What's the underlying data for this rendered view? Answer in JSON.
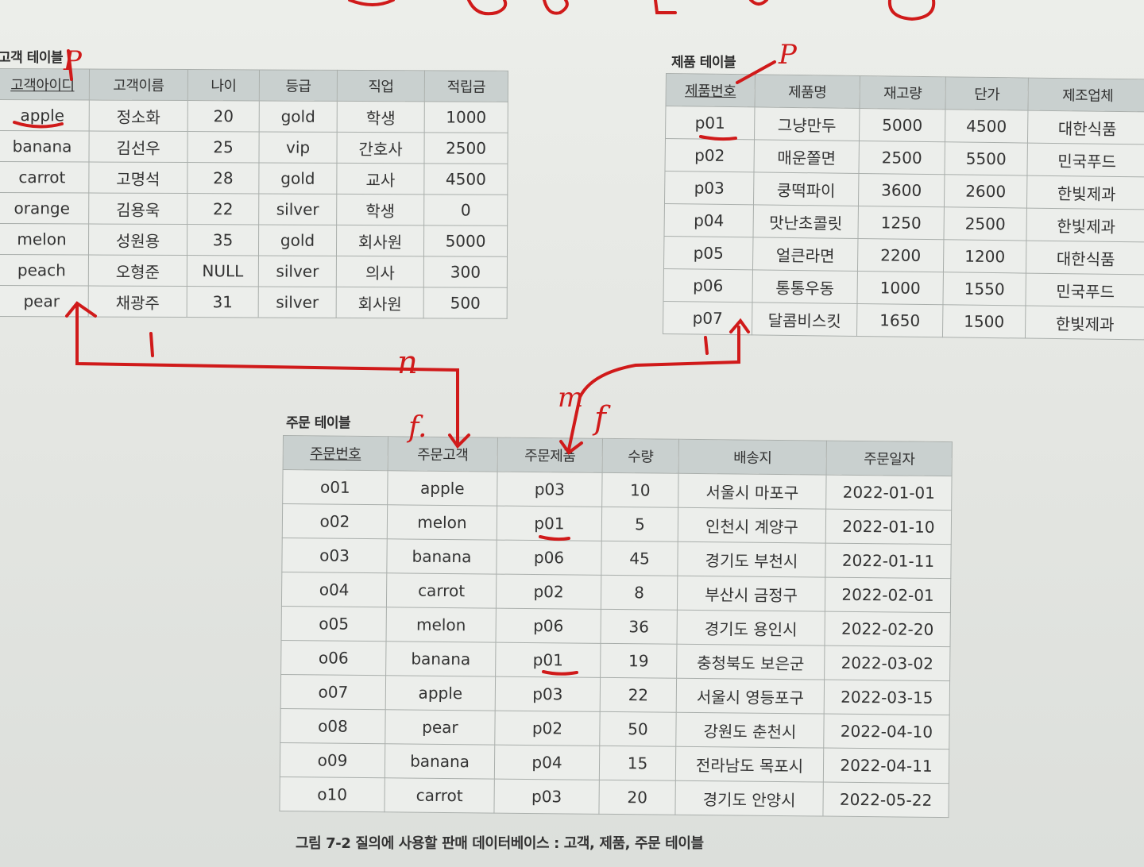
{
  "customer": {
    "title": "고객 테이블",
    "headers": [
      "고객아이디",
      "고객이름",
      "나이",
      "등급",
      "직업",
      "적립금"
    ],
    "rows": [
      [
        "apple",
        "정소화",
        "20",
        "gold",
        "학생",
        "1000"
      ],
      [
        "banana",
        "김선우",
        "25",
        "vip",
        "간호사",
        "2500"
      ],
      [
        "carrot",
        "고명석",
        "28",
        "gold",
        "교사",
        "4500"
      ],
      [
        "orange",
        "김용욱",
        "22",
        "silver",
        "학생",
        "0"
      ],
      [
        "melon",
        "성원용",
        "35",
        "gold",
        "회사원",
        "5000"
      ],
      [
        "peach",
        "오형준",
        "NULL",
        "silver",
        "의사",
        "300"
      ],
      [
        "pear",
        "채광주",
        "31",
        "silver",
        "회사원",
        "500"
      ]
    ]
  },
  "product": {
    "title": "제품 테이블",
    "headers": [
      "제품번호",
      "제품명",
      "재고량",
      "단가",
      "제조업체"
    ],
    "rows": [
      [
        "p01",
        "그냥만두",
        "5000",
        "4500",
        "대한식품"
      ],
      [
        "p02",
        "매운쫄면",
        "2500",
        "5500",
        "민국푸드"
      ],
      [
        "p03",
        "쿵떡파이",
        "3600",
        "2600",
        "한빛제과"
      ],
      [
        "p04",
        "맛난초콜릿",
        "1250",
        "2500",
        "한빛제과"
      ],
      [
        "p05",
        "얼큰라면",
        "2200",
        "1200",
        "대한식품"
      ],
      [
        "p06",
        "통통우동",
        "1000",
        "1550",
        "민국푸드"
      ],
      [
        "p07",
        "달콤비스킷",
        "1650",
        "1500",
        "한빛제과"
      ]
    ]
  },
  "order": {
    "title": "주문 테이블",
    "headers": [
      "주문번호",
      "주문고객",
      "주문제품",
      "수량",
      "배송지",
      "주문일자"
    ],
    "rows": [
      [
        "o01",
        "apple",
        "p03",
        "10",
        "서울시 마포구",
        "2022-01-01"
      ],
      [
        "o02",
        "melon",
        "p01",
        "5",
        "인천시 계양구",
        "2022-01-10"
      ],
      [
        "o03",
        "banana",
        "p06",
        "45",
        "경기도 부천시",
        "2022-01-11"
      ],
      [
        "o04",
        "carrot",
        "p02",
        "8",
        "부산시 금정구",
        "2022-02-01"
      ],
      [
        "o05",
        "melon",
        "p06",
        "36",
        "경기도 용인시",
        "2022-02-20"
      ],
      [
        "o06",
        "banana",
        "p01",
        "19",
        "충청북도 보은군",
        "2022-03-02"
      ],
      [
        "o07",
        "apple",
        "p03",
        "22",
        "서울시 영등포구",
        "2022-03-15"
      ],
      [
        "o08",
        "pear",
        "p02",
        "50",
        "강원도 춘천시",
        "2022-04-10"
      ],
      [
        "o09",
        "banana",
        "p04",
        "15",
        "전라남도 목포시",
        "2022-04-11"
      ],
      [
        "o10",
        "carrot",
        "p03",
        "20",
        "경기도 안양시",
        "2022-05-22"
      ]
    ]
  },
  "caption": "그림 7-2 질의에 사용할 판매 데이터베이스 : 고객, 제품, 주문 테이블",
  "annotations": {
    "customer_pk": "P",
    "product_pk": "P",
    "customer_side": "1",
    "product_side": "1",
    "order_customer_side": "n",
    "order_product_side": "m",
    "fk_customer": "f.",
    "fk_product": "f"
  },
  "ink_color": "#d01a1a"
}
